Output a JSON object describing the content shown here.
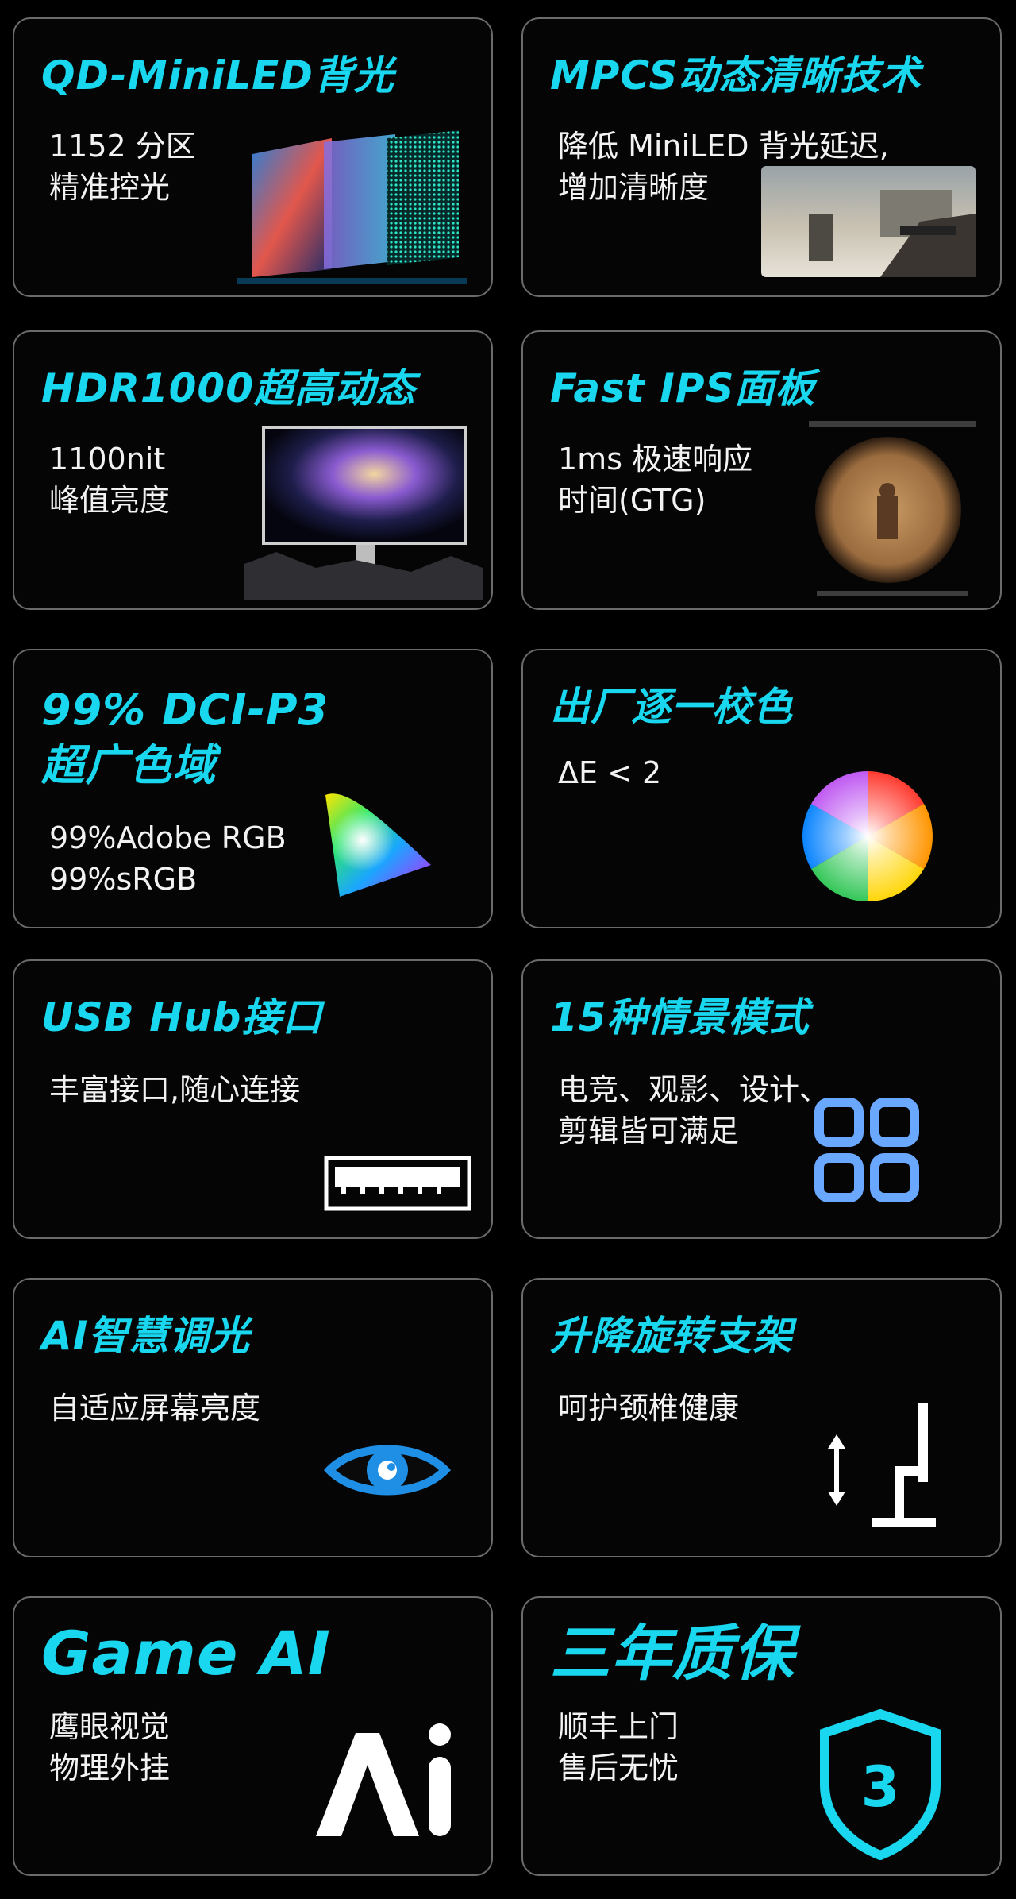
{
  "colors": {
    "accent": "#19d7ee",
    "background": "#000000",
    "card_border": "#6b6b6b",
    "text": "#f2f2f2"
  },
  "cards": [
    {
      "title": "QD-MiniLED背光",
      "lines": [
        "1152 分区",
        "精准控光"
      ],
      "icon": "miniled-layers-image"
    },
    {
      "title": "MPCS动态清晰技术",
      "lines": [
        "降低 MiniLED 背光延迟,",
        "增加清晰度"
      ],
      "icon": "shooter-game-screenshot"
    },
    {
      "title": "HDR1000超高动态",
      "lines": [
        "1100nit",
        "峰值亮度"
      ],
      "icon": "hdr-monitor-image"
    },
    {
      "title": "Fast IPS面板",
      "lines": [
        "1ms 极速响应",
        "时间(GTG)"
      ],
      "icon": "game-scope-image"
    },
    {
      "title": "99% DCI-P3",
      "title2": "超广色域",
      "lines": [
        "99%Adobe RGB",
        "99%sRGB"
      ],
      "icon": "color-gamut-triangle-icon"
    },
    {
      "title": "出厂逐一校色",
      "lines": [
        "ΔE < 2"
      ],
      "icon": "color-wheel-icon"
    },
    {
      "title": "USB Hub接口",
      "lines": [
        "丰富接口,随心连接"
      ],
      "icon": "usb-port-icon"
    },
    {
      "title": "15种情景模式",
      "lines": [
        "电竞、观影、设计、",
        "剪辑皆可满足"
      ],
      "icon": "mode-grid-icon"
    },
    {
      "title": "AI智慧调光",
      "lines": [
        "自适应屏幕亮度"
      ],
      "icon": "eye-icon"
    },
    {
      "title": "升降旋转支架",
      "lines": [
        "呵护颈椎健康"
      ],
      "icon": "stand-height-icon"
    },
    {
      "title": "Game AI",
      "lines": [
        "鹰眼视觉",
        "物理外挂"
      ],
      "icon": "ai-logo-icon"
    },
    {
      "title": "三年质保",
      "lines": [
        "顺丰上门",
        "售后无忧"
      ],
      "icon": "shield-warranty-icon",
      "badge": "3"
    }
  ]
}
